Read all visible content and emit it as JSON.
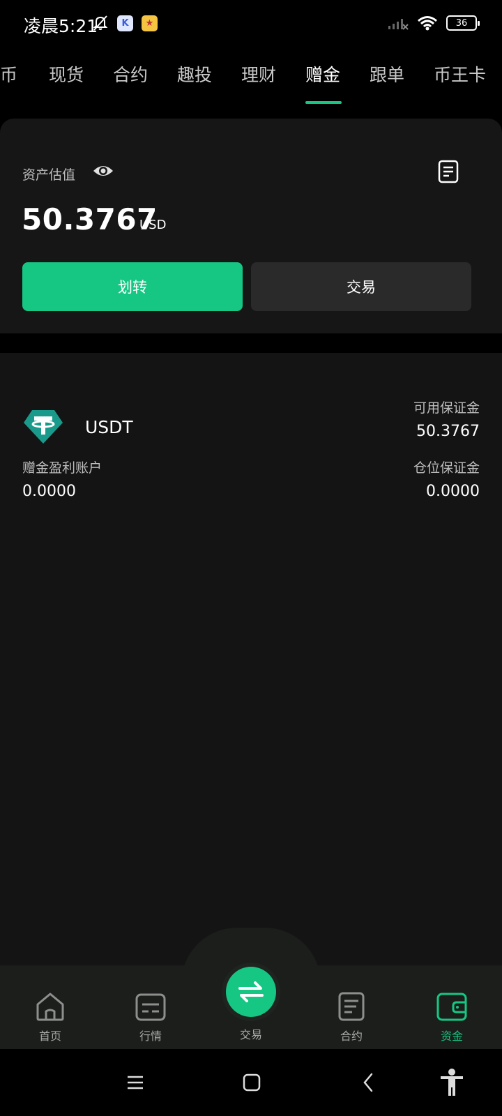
{
  "status_bar": {
    "time": "凌晨5:21",
    "battery": "36"
  },
  "tabs": [
    {
      "label": "币"
    },
    {
      "label": "现货"
    },
    {
      "label": "合约"
    },
    {
      "label": "趣投"
    },
    {
      "label": "理财"
    },
    {
      "label": "赠金",
      "active": true
    },
    {
      "label": "跟单"
    },
    {
      "label": "币王卡"
    }
  ],
  "asset": {
    "label": "资产估值",
    "value": "50.3767",
    "unit": "USD",
    "transfer_label": "划转",
    "trade_label": "交易"
  },
  "coin": {
    "name": "USDT",
    "available_margin_label": "可用保证金",
    "available_margin_value": "50.3767",
    "bonus_profit_label": "赠金盈利账户",
    "bonus_profit_value": "0.0000",
    "position_margin_label": "仓位保证金",
    "position_margin_value": "0.0000"
  },
  "bottom_nav": {
    "home": "首页",
    "market": "行情",
    "trade": "交易",
    "contract": "合约",
    "funds": "资金"
  },
  "colors": {
    "accent": "#16c784",
    "card": "#161616",
    "background": "#000000"
  }
}
